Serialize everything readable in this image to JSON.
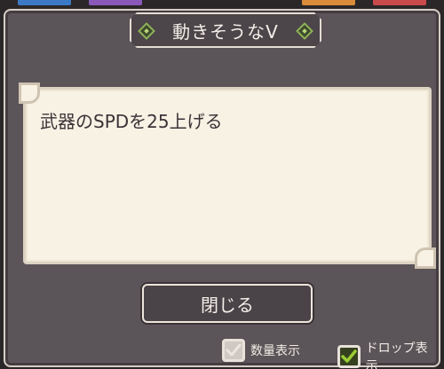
{
  "dialog": {
    "title": "動きそうなV",
    "description": "武器のSPDを25上げる",
    "close_label": "閉じる"
  },
  "options": [
    {
      "label": "数量表示",
      "checked": true,
      "enabled": false
    },
    {
      "label": "ドロップ表示",
      "checked": true,
      "enabled": true
    }
  ],
  "icons": {
    "title_left": "diamond-ornament-icon",
    "title_right": "diamond-ornament-icon",
    "check": "checkmark-icon"
  },
  "colors": {
    "dialog_bg": "#5b5458",
    "panel_bg": "#f7f2e4",
    "check_active": "#9acd32"
  }
}
